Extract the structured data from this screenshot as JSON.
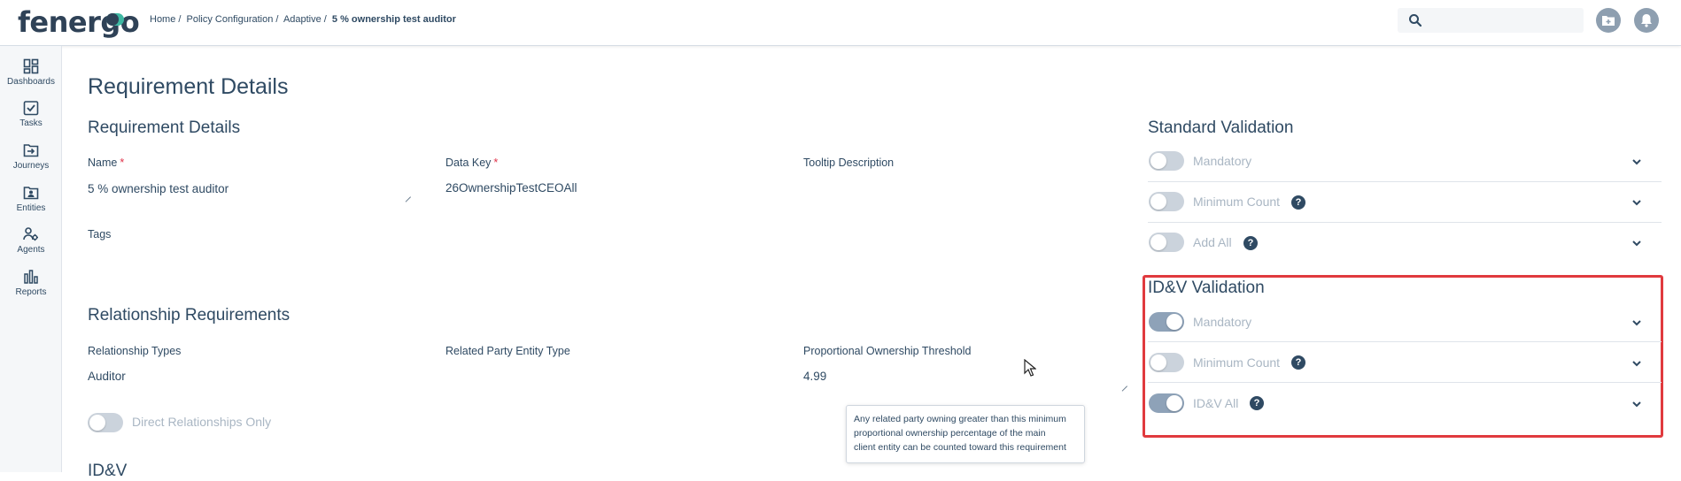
{
  "header": {
    "logo": "fenergo",
    "breadcrumb": [
      "Home /",
      "Policy Configuration /",
      "Adaptive /"
    ],
    "breadcrumb_current": "5 % ownership test auditor"
  },
  "sidebar": {
    "items": [
      {
        "label": "Dashboards",
        "icon": "dashboard-icon"
      },
      {
        "label": "Tasks",
        "icon": "tasks-icon"
      },
      {
        "label": "Journeys",
        "icon": "journeys-icon"
      },
      {
        "label": "Entities",
        "icon": "entities-icon"
      },
      {
        "label": "Agents",
        "icon": "agents-icon"
      },
      {
        "label": "Reports",
        "icon": "reports-icon"
      }
    ]
  },
  "main": {
    "page_title": "Requirement Details",
    "requirement": {
      "title": "Requirement Details",
      "name_label": "Name",
      "name_value": "5 % ownership test auditor",
      "datakey_label": "Data Key",
      "datakey_value": "26OwnershipTestCEOAll",
      "tooltip_label": "Tooltip Description",
      "tags_label": "Tags"
    },
    "relationship": {
      "title": "Relationship Requirements",
      "types_label": "Relationship Types",
      "types_value": "Auditor",
      "party_label": "Related Party Entity Type",
      "threshold_label": "Proportional Ownership Threshold",
      "threshold_value": "4.99",
      "direct_label": "Direct Relationships Only"
    },
    "idv_partial": "ID&V"
  },
  "standard_validation": {
    "title": "Standard Validation",
    "rows": [
      {
        "label": "Mandatory",
        "on": false,
        "help": false
      },
      {
        "label": "Minimum Count",
        "on": false,
        "help": true
      },
      {
        "label": "Add All",
        "on": false,
        "help": true
      }
    ]
  },
  "idv_validation": {
    "title": "ID&V Validation",
    "rows": [
      {
        "label": "Mandatory",
        "on": true,
        "help": false
      },
      {
        "label": "Minimum Count",
        "on": false,
        "help": true
      },
      {
        "label": "ID&V All",
        "on": true,
        "help": true
      }
    ]
  },
  "tooltip": {
    "lines": [
      "Any related party owning greater than this minimum",
      "proportional ownership percentage of the main",
      "client entity can be counted toward this requirement"
    ]
  },
  "help_glyph": "?"
}
